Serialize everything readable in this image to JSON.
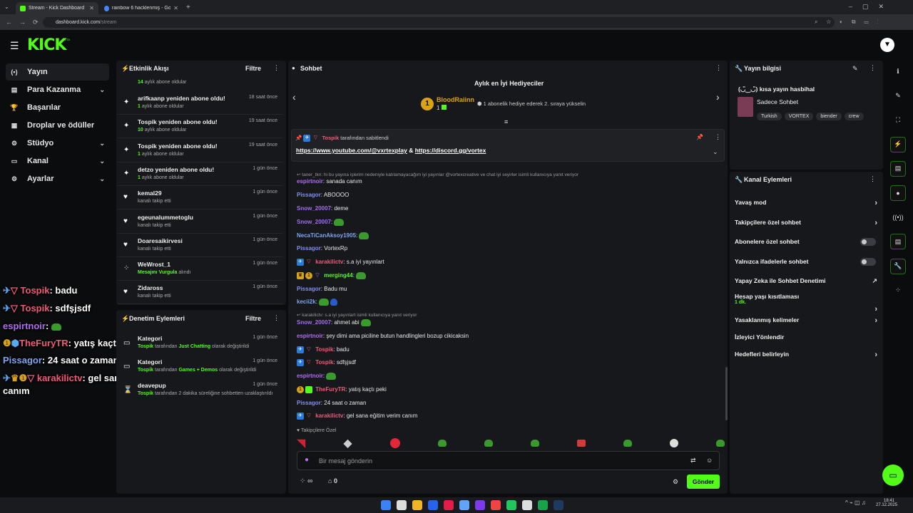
{
  "browser": {
    "tabs": [
      {
        "title": "Stream - Kick Dashboard",
        "close": "✕"
      },
      {
        "title": "rainbow 6 hacklenmiş - Google",
        "close": "✕"
      }
    ],
    "new_tab": "+",
    "url_host": "dashboard.kick.com",
    "url_path": "/stream"
  },
  "topbar": {
    "logo": "KICK",
    "beta": "BETA"
  },
  "leftnav": [
    {
      "label": "Yayın",
      "icon": "broadcast-icon",
      "active": true,
      "chevron": false
    },
    {
      "label": "Para Kazanma",
      "icon": "money-icon",
      "chevron": true
    },
    {
      "label": "Başarılar",
      "icon": "trophy-icon",
      "chevron": false
    },
    {
      "label": "Droplar ve ödüller",
      "icon": "gift-icon",
      "chevron": false
    },
    {
      "label": "Stüdyo",
      "icon": "studio-icon",
      "chevron": true
    },
    {
      "label": "Kanal",
      "icon": "channel-icon",
      "chevron": true
    },
    {
      "label": "Ayarlar",
      "icon": "gear-icon",
      "chevron": true
    }
  ],
  "activity": {
    "title": "Etkinlik Akışı",
    "filter": "Filtre",
    "partial_top": {
      "num": "14",
      "text": "aylık abone oldular"
    },
    "items": [
      {
        "title": "arifkaanp yeniden abone oldu!",
        "num": "1",
        "sub": "aylık abone oldular",
        "time": "18 saat önce",
        "icon": "sparkle-icon"
      },
      {
        "title": "Tospik yeniden abone oldu!",
        "num": "10",
        "sub": "aylık abone oldular",
        "time": "19 saat önce",
        "icon": "sparkle-icon"
      },
      {
        "title": "Tospik yeniden abone oldu!",
        "num": "1",
        "sub": "aylık abone oldular",
        "time": "19 saat önce",
        "icon": "sparkle-icon"
      },
      {
        "title": "detzo yeniden abone oldu!",
        "num": "1",
        "sub": "aylık abone oldular",
        "time": "1 gün önce",
        "icon": "sparkle-icon"
      },
      {
        "title": "kemal29",
        "num": "",
        "sub": "kanalı takip etti",
        "time": "1 gün önce",
        "icon": "heart-icon"
      },
      {
        "title": "egeunalummetoglu",
        "num": "",
        "sub": "kanalı takip etti",
        "time": "1 gün önce",
        "icon": "heart-icon"
      },
      {
        "title": "Doaresaikirvesi",
        "num": "",
        "sub": "kanalı takip etti",
        "time": "1 gün önce",
        "icon": "heart-icon"
      },
      {
        "title": "WeWrost_1",
        "num": "Mesajını Vurgula",
        "sub": "alındı",
        "time": "1 gün önce",
        "icon": "points-icon"
      },
      {
        "title": "Zidaross",
        "num": "",
        "sub": "kanalı takip etti",
        "time": "1 gün önce",
        "icon": "heart-icon"
      }
    ]
  },
  "moderation": {
    "title": "Denetim Eylemleri",
    "filter": "Filtre",
    "items": [
      {
        "title": "Kategori",
        "user": "Tospik",
        "mid": "tarafından",
        "hl": "Just Chatting",
        "rest": "olarak değiştirildi",
        "time": "1 gün önce"
      },
      {
        "title": "Kategori",
        "user": "Tospik",
        "mid": "tarafından",
        "hl": "Games + Demos",
        "rest": "olarak değiştirildi",
        "time": "1 gün önce"
      },
      {
        "title": "deavepup",
        "user": "Tospik",
        "mid": "tarafından 2 dakika süreliğine sohbetten",
        "hl": "",
        "rest": "uzaklaştırıldı",
        "time": "1 gün önce"
      }
    ]
  },
  "chat": {
    "title": "Sohbet",
    "top_gifters_title": "Aylık en İyi Hediyeciler",
    "top_gifter": {
      "name": "BloodRaiinn",
      "rank": "1",
      "count": "1"
    },
    "gifter_hint": "1 abonelik hediye ederek 2. sıraya yükselin",
    "pinned_by": "Tospik",
    "pinned_label": "tarafından sabitlendi",
    "pinned_link1": "https://www.youtube.com/@vxrtexplay",
    "pinned_amp": "&",
    "pinned_link2": "https://discord.gg/vortex",
    "reply1": "taner_tkn: hi bu yayına işlerim nedeniyle katılamayacağım iyi yayınlar @vortexcreative ve chat iyi seyirler isimli kullanıcıya yanıt veriyor",
    "reply2": "karakilictv: s.a iyi yayınlart isimli kullanıcıya yanıt veriyor",
    "messages": [
      {
        "user": "espirtnoir",
        "color": "#b06cf0",
        "text": "sanada canım"
      },
      {
        "user": "Pissagor",
        "color": "#7f8cf5",
        "text": "ABOOOO"
      },
      {
        "user": "Snow_20007",
        "color": "#a36cf0",
        "text": "deme"
      },
      {
        "user": "Snow_20007",
        "color": "#a36cf0",
        "text": ""
      },
      {
        "user": "NecaTiCanAksoy1905",
        "color": "#7fa6f0",
        "text": ""
      },
      {
        "user": "Pissagor",
        "color": "#7f8cf5",
        "text": "VortexRp"
      },
      {
        "user": "karakilictv",
        "color": "#f05a7a",
        "text": "s.a iyi yayınlart"
      },
      {
        "user": "merging44",
        "color": "#53fc18",
        "text": ""
      },
      {
        "user": "Pissagor",
        "color": "#7f8cf5",
        "text": "Badu mu"
      },
      {
        "user": "kecii2k",
        "color": "#7fa6f0",
        "text": ""
      },
      {
        "user": "Snow_20007",
        "color": "#a36cf0",
        "text": "ahmet abi"
      },
      {
        "user": "espirtnoir",
        "color": "#b06cf0",
        "text": "şey dimi ama piciline butun handlingleri bozup cikicaksin"
      },
      {
        "user": "Tospik",
        "color": "#f05a7a",
        "text": "badu"
      },
      {
        "user": "Tospik",
        "color": "#f05a7a",
        "text": "sdfşjsdf"
      },
      {
        "user": "espirtnoir",
        "color": "#b06cf0",
        "text": ""
      },
      {
        "user": "TheFuryTR",
        "color": "#f05a7a",
        "text": "yatış kaçtı peki"
      },
      {
        "user": "Pissagor",
        "color": "#7f8cf5",
        "text": "24 saat o zaman"
      },
      {
        "user": "karakilictv",
        "color": "#f05a7a",
        "text": "gel sana eğitim verim canım"
      }
    ],
    "followers_only": "Takipçilere Özel",
    "input_placeholder": "Bir mesaj gönderin",
    "points": "∞",
    "count": "0",
    "send": "Gönder"
  },
  "overlay": [
    {
      "user": "Tospik",
      "text": "badu",
      "color": "#f05a7a"
    },
    {
      "user": "Tospik",
      "text": "sdfşjsdf",
      "color": "#f05a7a"
    },
    {
      "user": "espirtnoir",
      "text": "",
      "color": "#b06cf0"
    },
    {
      "user": "TheFuryTR",
      "text": "yatış kaçtı peki",
      "color": "#f05a7a"
    },
    {
      "user": "Pissagor",
      "text": "24 saat o zaman",
      "color": "#7fa6f0"
    },
    {
      "user": "karakilictv",
      "text": "gel sana eğitim verim",
      "color": "#f05a7a"
    },
    {
      "user": "",
      "text": "canım",
      "color": "#ffffff"
    }
  ],
  "stream_info": {
    "title": "Yayın bilgisi",
    "stream_title": "(◡̈‿◡̈) kısa yayın hasbihal",
    "category": "Sadece Sohbet",
    "tags": [
      "Turkish",
      "VORTEX",
      "biender",
      "crew"
    ]
  },
  "channel_actions": {
    "title": "Kanal Eylemleri",
    "items": [
      {
        "label": "Yavaş mod",
        "type": "chevron"
      },
      {
        "label": "Takipçilere özel sohbet",
        "type": "chevron"
      },
      {
        "label": "Abonelere özel sohbet",
        "type": "toggle"
      },
      {
        "label": "Yalnızca ifadelerle sohbet",
        "type": "toggle"
      },
      {
        "label": "Yapay Zeka ile Sohbet Denetimi",
        "type": "external"
      },
      {
        "label": "Hesap yaşı kısıtlaması",
        "type": "chevron",
        "sub": "1 dk."
      },
      {
        "label": "Yasaklanmış kelimeler",
        "type": "chevron"
      },
      {
        "label": "İzleyici Yönlendir",
        "type": "none"
      },
      {
        "label": "Hedefleri belirleyin",
        "type": "chevron"
      }
    ]
  },
  "taskbar": {
    "time": "18:41",
    "date": "27.12.2025"
  },
  "colors": {
    "accent": "#53fc18",
    "bg": "#0b0c0d",
    "panel": "#17181b"
  }
}
